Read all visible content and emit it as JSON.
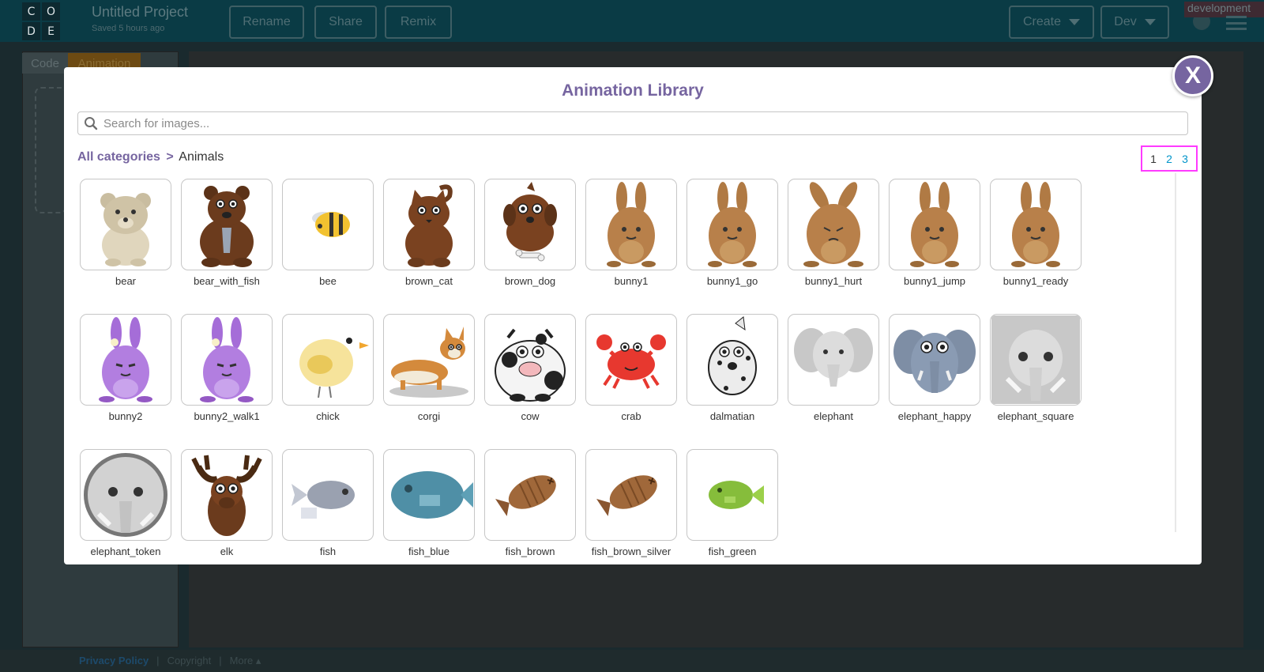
{
  "app": {
    "logo_letters": [
      "C",
      "O",
      "D",
      "E"
    ],
    "project_title": "Untitled Project",
    "saved_text": "Saved 5 hours ago",
    "buttons": {
      "rename": "Rename",
      "share": "Share",
      "remix": "Remix",
      "create": "Create",
      "dev": "Dev"
    },
    "env_badge": "development",
    "tabs": {
      "code": "Code",
      "animation": "Animation"
    },
    "footer": {
      "privacy": "Privacy Policy",
      "sep": "|",
      "copyright": "Copyright",
      "more": "More ▴"
    }
  },
  "modal": {
    "title": "Animation Library",
    "close_label": "X",
    "search": {
      "placeholder": "Search for images..."
    },
    "breadcrumb": {
      "all": "All categories",
      "separator": ">",
      "current": "Animals"
    },
    "pagination": {
      "pages": [
        "1",
        "2",
        "3"
      ],
      "current": "1"
    },
    "items": [
      {
        "name": "bear",
        "icon": "bear"
      },
      {
        "name": "bear_with_fish",
        "icon": "bear-fish"
      },
      {
        "name": "bee",
        "icon": "bee"
      },
      {
        "name": "brown_cat",
        "icon": "cat"
      },
      {
        "name": "brown_dog",
        "icon": "dog"
      },
      {
        "name": "bunny1",
        "icon": "bunny"
      },
      {
        "name": "bunny1_go",
        "icon": "bunny"
      },
      {
        "name": "bunny1_hurt",
        "icon": "bunny-hurt"
      },
      {
        "name": "bunny1_jump",
        "icon": "bunny"
      },
      {
        "name": "bunny1_ready",
        "icon": "bunny"
      },
      {
        "name": "bunny2",
        "icon": "bunny-purple"
      },
      {
        "name": "bunny2_walk1",
        "icon": "bunny-purple"
      },
      {
        "name": "chick",
        "icon": "chick"
      },
      {
        "name": "corgi",
        "icon": "corgi"
      },
      {
        "name": "cow",
        "icon": "cow"
      },
      {
        "name": "crab",
        "icon": "crab"
      },
      {
        "name": "dalmatian",
        "icon": "dalmatian"
      },
      {
        "name": "elephant",
        "icon": "elephant"
      },
      {
        "name": "elephant_happy",
        "icon": "elephant-happy"
      },
      {
        "name": "elephant_square",
        "icon": "elephant-square"
      },
      {
        "name": "elephant_token",
        "icon": "elephant-token"
      },
      {
        "name": "elk",
        "icon": "elk"
      },
      {
        "name": "fish",
        "icon": "fish"
      },
      {
        "name": "fish_blue",
        "icon": "fish-blue"
      },
      {
        "name": "fish_brown",
        "icon": "fish-bone"
      },
      {
        "name": "fish_brown_silver",
        "icon": "fish-bone"
      },
      {
        "name": "fish_green",
        "icon": "fish-green"
      }
    ]
  },
  "colors": {
    "accent": "#7665a0",
    "link": "#0094ca",
    "highlight": "#ff3bff"
  }
}
